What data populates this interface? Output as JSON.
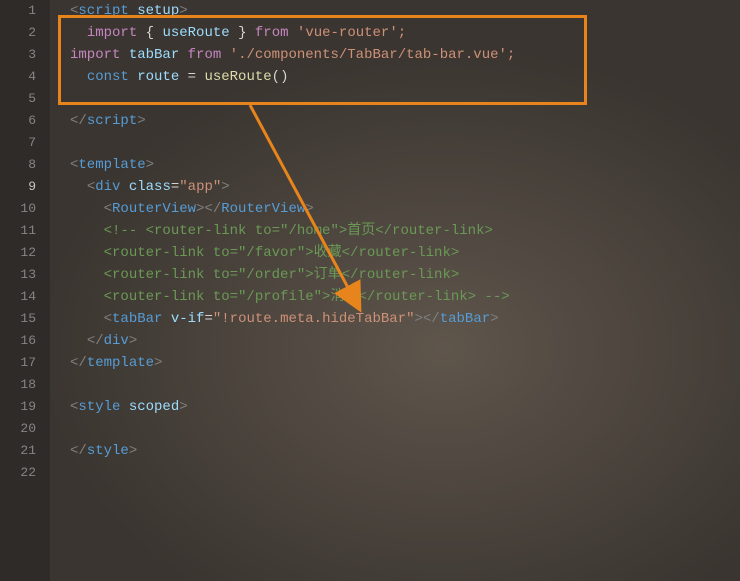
{
  "gutter": {
    "lines": [
      "1",
      "2",
      "3",
      "4",
      "5",
      "6",
      "7",
      "8",
      "9",
      "10",
      "11",
      "12",
      "13",
      "14",
      "15",
      "16",
      "17",
      "18",
      "19",
      "20",
      "21",
      "22"
    ],
    "active": 9
  },
  "code": {
    "l1": {
      "a": "<",
      "b": "script",
      "c": " setup",
      "d": ">"
    },
    "l2": {
      "a": "import",
      "b": " { ",
      "c": "useRoute",
      "d": " } ",
      "e": "from",
      "f": " '",
      "g": "vue-router",
      "h": "';"
    },
    "l3": {
      "a": "import",
      "b": " tabBar ",
      "c": "from",
      "d": " '",
      "e": "./components/TabBar/tab-bar.vue",
      "f": "';"
    },
    "l4": {
      "a": "const",
      "b": " route ",
      "c": "=",
      "d": " useRoute",
      "e": "()"
    },
    "l6": {
      "a": "</",
      "b": "script",
      "c": ">"
    },
    "l8": {
      "a": "<",
      "b": "template",
      "c": ">"
    },
    "l9": {
      "a": "<",
      "b": "div",
      "c": " class",
      "d": "=",
      "e": "\"app\"",
      "f": ">"
    },
    "l10": {
      "a": "<",
      "b": "RouterView",
      "c": "></",
      "d": "RouterView",
      "e": ">"
    },
    "l11": {
      "a": "<!-- ",
      "b": "<router-link to=\"/home\">首页</router-link>"
    },
    "l12": {
      "a": "<router-link to=\"/favor\">收藏</router-link>"
    },
    "l13": {
      "a": "<router-link to=\"/order\">订单</router-link>"
    },
    "l14": {
      "a": "<router-link to=\"/profile\">消息</router-link>",
      "b": " -->"
    },
    "l15": {
      "a": "<",
      "b": "tabBar",
      "c": " v-if",
      "d": "=",
      "e": "\"!route.meta.hideTabBar\"",
      "f": "></",
      "g": "tabBar",
      "h": ">"
    },
    "l16": {
      "a": "</",
      "b": "div",
      "c": ">"
    },
    "l17": {
      "a": "</",
      "b": "template",
      "c": ">"
    },
    "l19": {
      "a": "<",
      "b": "style",
      "c": " scoped",
      "d": ">"
    },
    "l21": {
      "a": "</",
      "b": "style",
      "c": ">"
    }
  }
}
